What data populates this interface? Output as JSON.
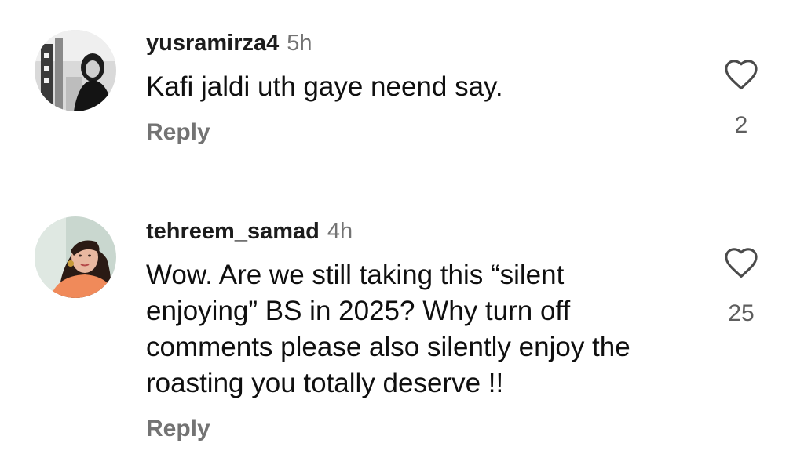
{
  "comments": [
    {
      "username": "yusramirza4",
      "time": "5h",
      "text": "Kafi jaldi uth gaye neend say.",
      "reply_label": "Reply",
      "likes": "2",
      "avatar_icon": "avatar-photo-grayscale",
      "like_icon": "heart-outline-icon"
    },
    {
      "username": "tehreem_samad",
      "time": "4h",
      "text": "Wow. Are we still taking this “silent enjoying” BS in 2025? Why turn off comments please also silently enjoy the roasting you totally deserve !!",
      "reply_label": "Reply",
      "likes": "25",
      "avatar_icon": "avatar-photo-color",
      "like_icon": "heart-outline-icon"
    }
  ],
  "colors": {
    "text_primary": "#0f0f0f",
    "text_secondary": "#737373",
    "background": "#ffffff"
  }
}
